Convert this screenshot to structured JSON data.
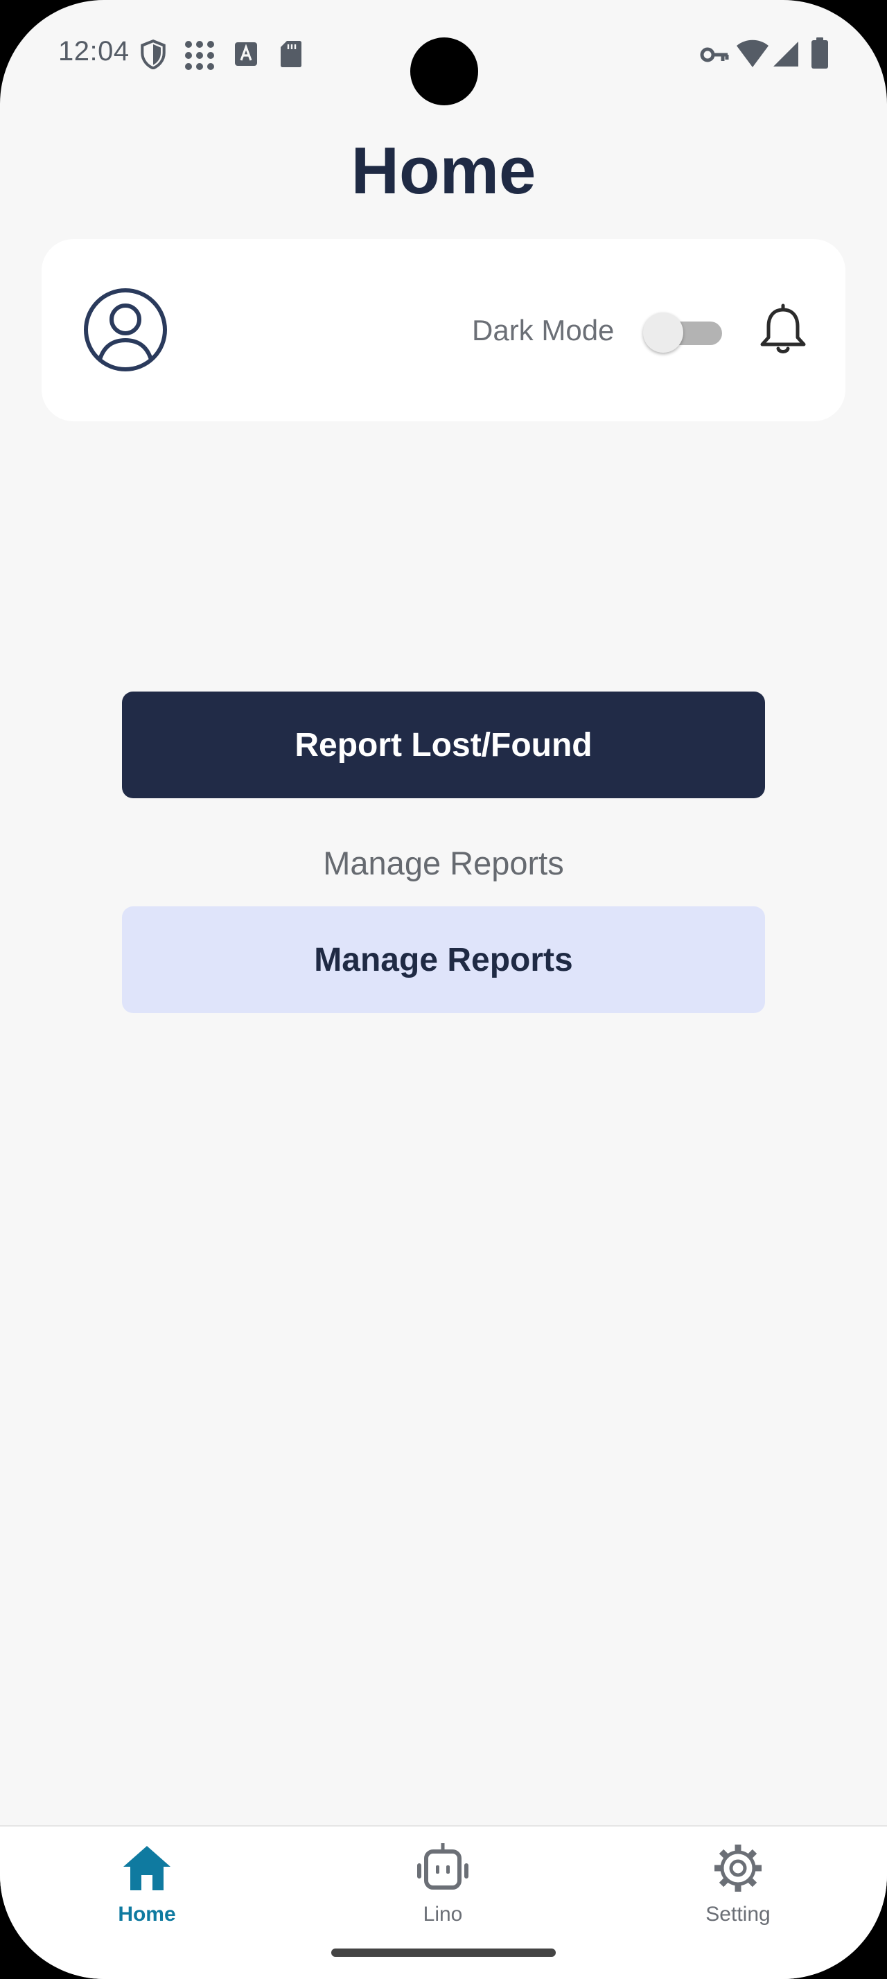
{
  "status_bar": {
    "time": "12:04",
    "icons_left": [
      "shield-icon",
      "apps-grid-icon",
      "font-a-icon",
      "sd-card-icon"
    ],
    "icons_right": [
      "vpn-key-icon",
      "wifi-icon",
      "signal-icon",
      "battery-icon"
    ]
  },
  "page": {
    "title": "Home"
  },
  "header_card": {
    "avatar_icon": "account-circle-icon",
    "dark_mode_label": "Dark Mode",
    "dark_mode_on": false,
    "notification_icon": "bell-icon"
  },
  "actions": {
    "report_button": "Report Lost/Found",
    "manage_section_label": "Manage Reports",
    "manage_button": "Manage Reports"
  },
  "bottom_nav": {
    "items": [
      {
        "label": "Home",
        "icon": "home-icon",
        "active": true
      },
      {
        "label": "Lino",
        "icon": "robot-icon",
        "active": false
      },
      {
        "label": "Setting",
        "icon": "gear-icon",
        "active": false
      }
    ]
  },
  "colors": {
    "background": "#f7f7f7",
    "primary": "#212b47",
    "secondary_button": "#dfe4fa",
    "nav_active": "#0f7aa0",
    "nav_inactive": "#6b6f76"
  }
}
